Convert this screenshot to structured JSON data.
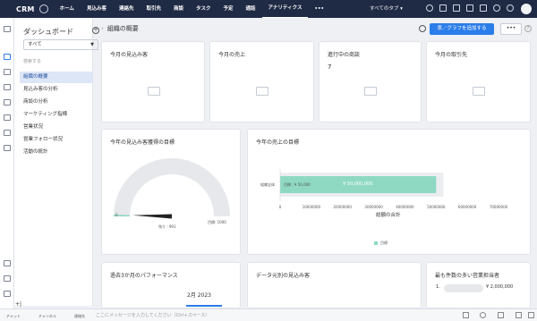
{
  "topbar": {
    "logo": "CRM",
    "nav": [
      "ホーム",
      "見込み客",
      "連絡先",
      "取引先",
      "商談",
      "タスク",
      "予定",
      "通話",
      "アナリティクス",
      "•••"
    ],
    "active_index": 8,
    "tab_select": "すべてのタブ ▾",
    "icons": [
      "search-icon",
      "add-icon",
      "check-icon",
      "grid-icon",
      "calendar-icon",
      "bell-icon",
      "gear-icon"
    ]
  },
  "sidebar": {
    "title": "ダッシュボード",
    "add_symbol": "+",
    "filter": "すべて",
    "search_placeholder": "検索する",
    "items": [
      "組織の概要",
      "見込み客の分析",
      "商談の分析",
      "マーケティング指標",
      "営業状況",
      "営業フォロー状況",
      "活動の統計"
    ],
    "selected_index": 0
  },
  "header": {
    "breadcrumb": "組織の概要",
    "add_button": "表／グラフを追加する",
    "more_button": "•••",
    "help": "?"
  },
  "kpis": [
    {
      "title": "今月の見込み客",
      "value": ""
    },
    {
      "title": "今月の売上",
      "value": ""
    },
    {
      "title": "進行中の商談",
      "value": "7"
    },
    {
      "title": "今月の取引先",
      "value": ""
    }
  ],
  "gauge": {
    "title": "今年の見込み客獲得の目標",
    "min_label": "0",
    "max_label": "目標: 1000",
    "value_label": "残り : 991",
    "value": 9,
    "target": 1000
  },
  "revenue_chart": {
    "title": "今年の売上の目標",
    "row_label": "組織全体",
    "target_label": "目標 : ¥ 50,000",
    "bar_label": "¥ 50,000,000",
    "xlabel": "総額の合計",
    "legend": "目標",
    "colors": {
      "fill": "#8fd9c2",
      "track": "#ebedf0"
    }
  },
  "chart_data": {
    "type": "bar",
    "categories": [
      "組織全体"
    ],
    "series": [
      {
        "name": "目標",
        "values": [
          50000000
        ]
      }
    ],
    "x_ticks": [
      "0",
      "10000000",
      "20000000",
      "30000000",
      "40000000",
      "50000000",
      "60000000",
      "70000000"
    ],
    "xlim": [
      0,
      70000000
    ],
    "xlabel": "総額の合計",
    "title": "今年の売上の目標"
  },
  "bottom_cards": [
    {
      "title": "過去3か月のパフォーマンス",
      "sub": "2月 2023"
    },
    {
      "title": "データ元別の見込み客",
      "sub": ""
    },
    {
      "title": "最も件数の多い営業担当者",
      "rank": "1.",
      "value": "¥ 2,000,000"
    }
  ],
  "bottombar": {
    "items": [
      "チャット",
      "チャンネル",
      "連絡先"
    ],
    "chat_placeholder": "ここにメッセージを入力してください（Ctrl+スペース）"
  }
}
